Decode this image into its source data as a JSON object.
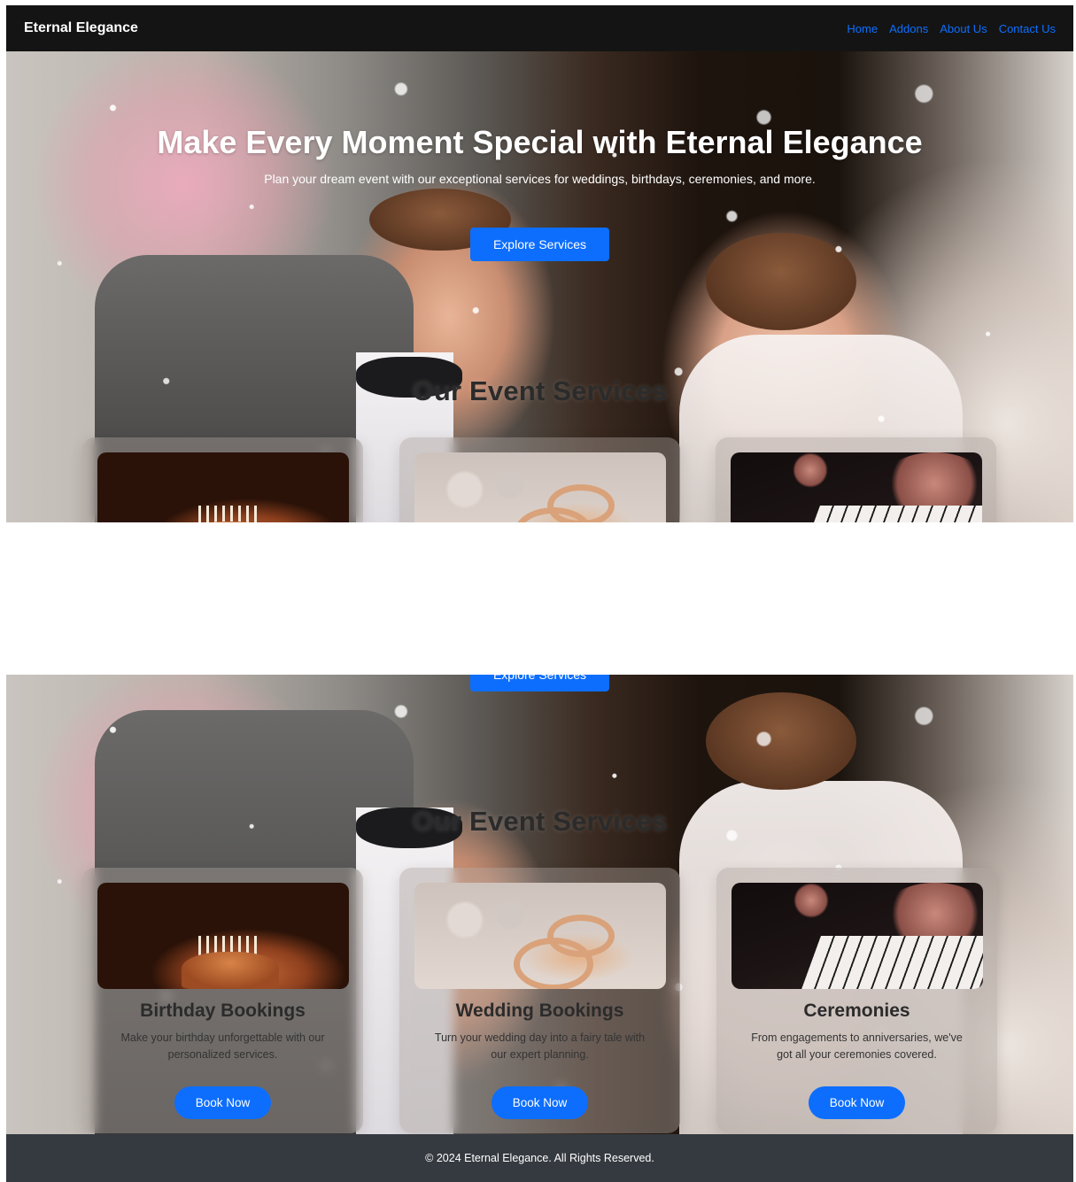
{
  "navbar": {
    "brand": "Eternal Elegance",
    "links": [
      "Home",
      "Addons",
      "About Us",
      "Contact Us"
    ]
  },
  "hero": {
    "title": "Make Every Moment Special with Eternal Elegance",
    "subtitle": "Plan your dream event with our exceptional services for weddings, birthdays, ceremonies, and more.",
    "cta_label": "Explore Services"
  },
  "services": {
    "section_title": "Our Event Services",
    "cards": [
      {
        "title": "Birthday Bookings",
        "text": "Make your birthday unforgettable with our personalized services.",
        "button": "Book Now"
      },
      {
        "title": "Wedding Bookings",
        "text": "Turn your wedding day into a fairy tale with our expert planning.",
        "button": "Book Now"
      },
      {
        "title": "Ceremonies",
        "text": "From engagements to anniversaries, we've got all your ceremonies covered.",
        "button": "Book Now"
      }
    ]
  },
  "footer": {
    "copyright": "© 2024 Eternal Elegance. All Rights Reserved."
  },
  "colors": {
    "accent": "#0d6efd",
    "navbar_bg": "#141414",
    "footer_bg": "#353a40"
  }
}
